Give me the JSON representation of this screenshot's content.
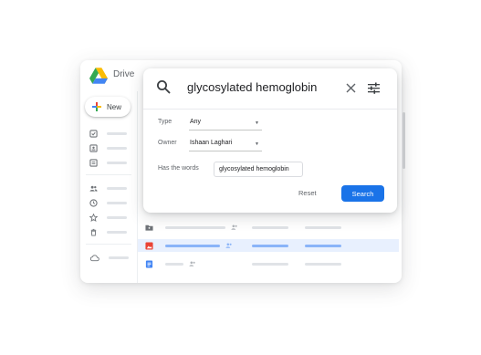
{
  "app": {
    "brand": "Drive"
  },
  "sidebar": {
    "new_label": "New",
    "items": [
      {
        "icon": "checkbox-icon"
      },
      {
        "icon": "contact-icon"
      },
      {
        "icon": "form-icon"
      },
      {
        "icon": "people-icon"
      },
      {
        "icon": "clock-icon"
      },
      {
        "icon": "star-icon"
      },
      {
        "icon": "trash-icon"
      },
      {
        "icon": "cloud-icon"
      }
    ]
  },
  "search": {
    "query": "glycosylated hemoglobin",
    "filters": {
      "type_label": "Type",
      "type_value": "Any",
      "owner_label": "Owner",
      "owner_value": "Ishaan Laghari",
      "words_label": "Has the words",
      "words_value": "glycosylated hemoglobin"
    },
    "reset_label": "Reset",
    "search_label": "Search"
  },
  "colors": {
    "accent": "#1a73e8",
    "selected_row": "#e8f0fe"
  }
}
